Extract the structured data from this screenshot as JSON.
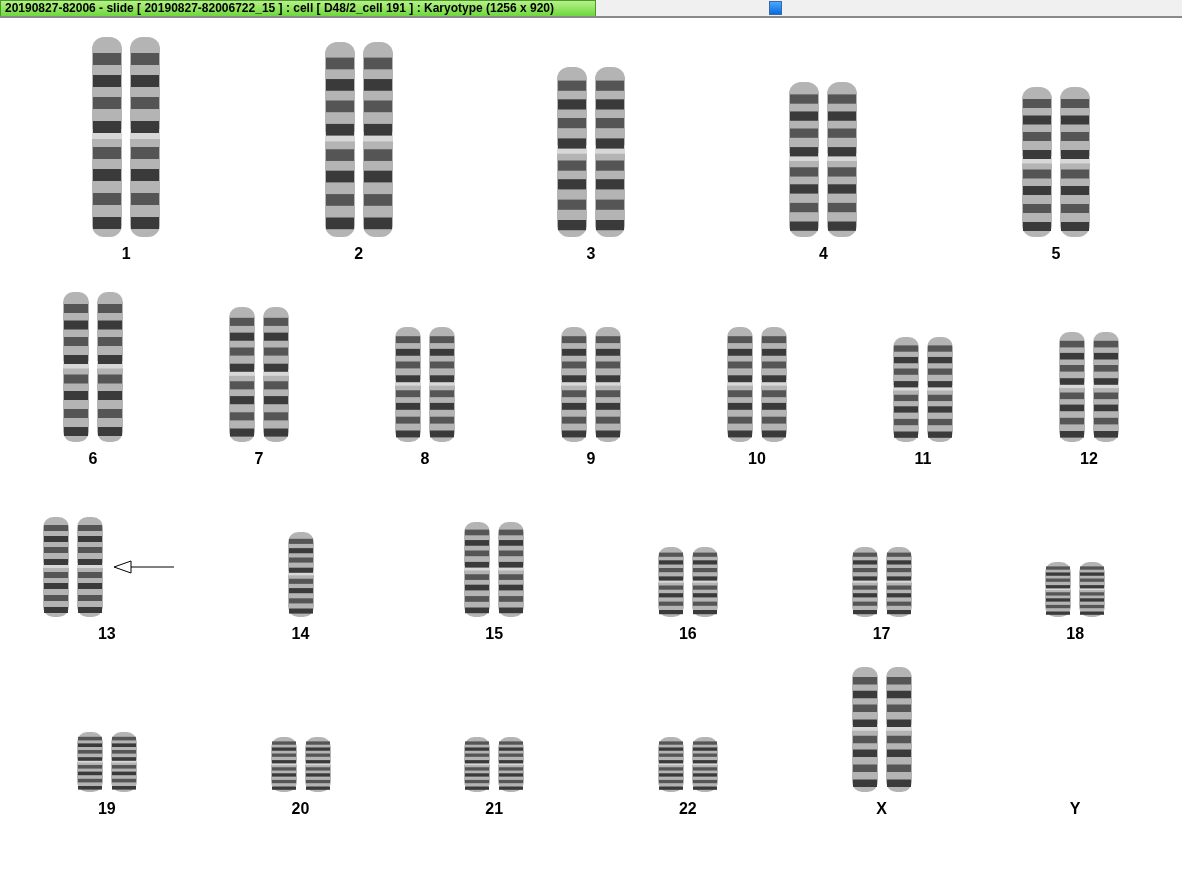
{
  "title_bar": {
    "title": "20190827-82006 - slide [  20190827-82006722_15 ] : cell [ D48/2_cell 191 ] : Karyotype  (1256 x 920)"
  },
  "karyotype": {
    "rows": [
      [
        {
          "label": "1",
          "kind": "pair",
          "arrow": false
        },
        {
          "label": "2",
          "kind": "pair",
          "arrow": false
        },
        {
          "label": "3",
          "kind": "pair",
          "arrow": false
        },
        {
          "label": "4",
          "kind": "pair",
          "arrow": false
        },
        {
          "label": "5",
          "kind": "pair",
          "arrow": false
        }
      ],
      [
        {
          "label": "6",
          "kind": "pair",
          "arrow": false
        },
        {
          "label": "7",
          "kind": "pair",
          "arrow": false
        },
        {
          "label": "8",
          "kind": "pair",
          "arrow": false
        },
        {
          "label": "9",
          "kind": "pair",
          "arrow": false
        },
        {
          "label": "10",
          "kind": "pair",
          "arrow": false
        },
        {
          "label": "11",
          "kind": "pair",
          "arrow": false
        },
        {
          "label": "12",
          "kind": "pair",
          "arrow": false
        }
      ],
      [
        {
          "label": "13",
          "kind": "pair",
          "arrow": true
        },
        {
          "label": "14",
          "kind": "single",
          "arrow": false
        },
        {
          "label": "15",
          "kind": "pair",
          "arrow": false
        },
        {
          "label": "16",
          "kind": "pair",
          "arrow": false
        },
        {
          "label": "17",
          "kind": "pair",
          "arrow": false
        },
        {
          "label": "18",
          "kind": "pair",
          "arrow": false
        }
      ],
      [
        {
          "label": "19",
          "kind": "pair",
          "arrow": false
        },
        {
          "label": "20",
          "kind": "pair",
          "arrow": false
        },
        {
          "label": "21",
          "kind": "pair",
          "arrow": false
        },
        {
          "label": "22",
          "kind": "pair",
          "arrow": false
        },
        {
          "label": "X",
          "kind": "pair",
          "arrow": false
        },
        {
          "label": "Y",
          "kind": "empty",
          "arrow": false
        }
      ]
    ]
  }
}
